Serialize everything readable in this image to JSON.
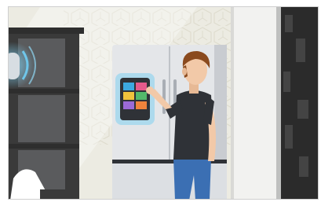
{
  "scene": {
    "subject": "man-using-smart-fridge-touchscreen",
    "colors": {
      "wall": "#ecebe2",
      "wall_pattern": "#e2e1d5",
      "fridge": "#e4e6e9",
      "fridge_shadow": "#c9ccd1",
      "shelf": "#3a3a3a",
      "shelf_inner": "#5a5b5d",
      "door_wall": "#f2f2f0",
      "dark_panel": "#2b2b2b",
      "screen_glow": "#7fd0f0",
      "skin": "#f2c9a8",
      "hair": "#8a4a1e",
      "shirt": "#2f3237",
      "jeans": "#3b6fb3"
    },
    "icons": [
      "speaker-glow-icon",
      "touchscreen-tiles-icon"
    ]
  }
}
